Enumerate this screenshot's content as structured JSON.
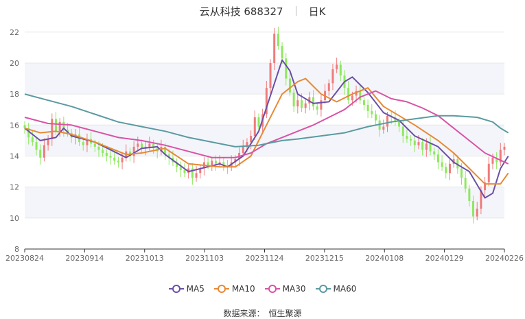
{
  "header": {
    "stock": "云从科技 688327",
    "period": "日K"
  },
  "chart_data": {
    "type": "candlestick",
    "y_ticks": [
      8,
      10,
      12,
      14,
      16,
      18,
      20,
      22
    ],
    "ylim": [
      8,
      22.3
    ],
    "x_ticks": [
      "20230824",
      "20230914",
      "20231013",
      "20231103",
      "20231124",
      "20231215",
      "20240108",
      "20240129",
      "20240226"
    ],
    "n_days": 124,
    "up_color": "#ef7b7b",
    "down_color": "#8ee85e",
    "grid": "horizontal",
    "shaded_bands": [
      [
        10,
        12
      ],
      [
        14,
        16
      ],
      [
        18,
        20
      ]
    ],
    "candles_close": [
      15.8,
      15.2,
      14.9,
      14.4,
      13.9,
      14.7,
      15.1,
      16.4,
      15.6,
      16.2,
      15.7,
      15.5,
      15.2,
      15.4,
      14.9,
      14.7,
      15.1,
      14.8,
      14.6,
      14.4,
      14.2,
      14.0,
      13.9,
      13.7,
      13.6,
      13.9,
      14.3,
      14.0,
      14.6,
      14.8,
      14.5,
      14.6,
      14.8,
      14.5,
      14.3,
      14.6,
      14.1,
      13.9,
      13.6,
      13.3,
      13.1,
      12.9,
      13.2,
      12.6,
      12.9,
      13.2,
      13.6,
      13.4,
      13.7,
      13.5,
      13.6,
      13.4,
      13.3,
      13.6,
      13.8,
      14.2,
      14.6,
      14.9,
      15.3,
      16.5,
      15.9,
      16.7,
      18.4,
      20.0,
      21.9,
      21.1,
      20.3,
      19.0,
      18.1,
      17.2,
      17.6,
      17.1,
      17.4,
      17.8,
      17.2,
      17.0,
      17.6,
      18.2,
      18.7,
      19.6,
      19.9,
      19.2,
      18.4,
      17.6,
      17.9,
      18.2,
      17.6,
      17.3,
      16.9,
      16.7,
      16.3,
      15.7,
      15.9,
      16.6,
      16.5,
      16.2,
      15.9,
      15.3,
      15.1,
      15.0,
      14.7,
      14.9,
      14.4,
      14.8,
      14.3,
      14.1,
      13.6,
      13.3,
      12.9,
      13.5,
      13.8,
      13.2,
      12.6,
      11.9,
      11.1,
      10.1,
      10.6,
      11.8,
      12.3,
      13.5,
      13.9,
      13.6,
      14.4,
      14.6
    ],
    "series": [
      {
        "name": "MA5",
        "color": "#6b4ea6",
        "points": [
          [
            0,
            15.8
          ],
          [
            4,
            15.0
          ],
          [
            8,
            15.2
          ],
          [
            10,
            15.8
          ],
          [
            12,
            15.3
          ],
          [
            18,
            14.9
          ],
          [
            26,
            13.9
          ],
          [
            30,
            14.5
          ],
          [
            34,
            14.6
          ],
          [
            36,
            14.1
          ],
          [
            42,
            13.0
          ],
          [
            50,
            13.5
          ],
          [
            52,
            13.3
          ],
          [
            56,
            14.0
          ],
          [
            60,
            15.6
          ],
          [
            66,
            20.2
          ],
          [
            68,
            19.5
          ],
          [
            70,
            18.0
          ],
          [
            74,
            17.4
          ],
          [
            78,
            17.5
          ],
          [
            82,
            18.8
          ],
          [
            84,
            19.1
          ],
          [
            88,
            18.1
          ],
          [
            92,
            16.8
          ],
          [
            96,
            16.3
          ],
          [
            100,
            15.3
          ],
          [
            106,
            14.6
          ],
          [
            110,
            13.6
          ],
          [
            114,
            13.0
          ],
          [
            118,
            11.3
          ],
          [
            120,
            11.6
          ],
          [
            122,
            13.2
          ],
          [
            124,
            14.0
          ]
        ]
      },
      {
        "name": "MA10",
        "color": "#e78934",
        "points": [
          [
            0,
            15.8
          ],
          [
            4,
            15.5
          ],
          [
            8,
            15.6
          ],
          [
            12,
            15.4
          ],
          [
            18,
            14.9
          ],
          [
            26,
            14.1
          ],
          [
            30,
            14.2
          ],
          [
            36,
            14.5
          ],
          [
            42,
            13.5
          ],
          [
            50,
            13.3
          ],
          [
            54,
            13.3
          ],
          [
            58,
            14.0
          ],
          [
            62,
            16.0
          ],
          [
            66,
            18.0
          ],
          [
            70,
            18.8
          ],
          [
            72,
            19.0
          ],
          [
            76,
            18.0
          ],
          [
            80,
            17.5
          ],
          [
            84,
            18.0
          ],
          [
            88,
            18.4
          ],
          [
            92,
            17.2
          ],
          [
            96,
            16.6
          ],
          [
            100,
            16.0
          ],
          [
            106,
            15.0
          ],
          [
            110,
            14.2
          ],
          [
            114,
            13.2
          ],
          [
            118,
            12.2
          ],
          [
            122,
            12.2
          ],
          [
            124,
            12.9
          ]
        ]
      },
      {
        "name": "MA30",
        "color": "#d853a6",
        "points": [
          [
            0,
            16.5
          ],
          [
            6,
            16.1
          ],
          [
            12,
            16.0
          ],
          [
            18,
            15.6
          ],
          [
            24,
            15.2
          ],
          [
            30,
            15.0
          ],
          [
            36,
            14.7
          ],
          [
            42,
            14.3
          ],
          [
            48,
            13.9
          ],
          [
            54,
            13.9
          ],
          [
            58,
            14.2
          ],
          [
            62,
            14.8
          ],
          [
            66,
            15.2
          ],
          [
            70,
            15.6
          ],
          [
            74,
            16.0
          ],
          [
            78,
            16.5
          ],
          [
            82,
            17.0
          ],
          [
            86,
            17.8
          ],
          [
            90,
            18.2
          ],
          [
            94,
            17.7
          ],
          [
            98,
            17.5
          ],
          [
            102,
            17.1
          ],
          [
            106,
            16.6
          ],
          [
            110,
            15.8
          ],
          [
            114,
            15.0
          ],
          [
            118,
            14.2
          ],
          [
            124,
            13.5
          ]
        ]
      },
      {
        "name": "MA60",
        "color": "#5a9aa0",
        "points": [
          [
            0,
            18.0
          ],
          [
            6,
            17.6
          ],
          [
            12,
            17.2
          ],
          [
            18,
            16.7
          ],
          [
            24,
            16.2
          ],
          [
            30,
            15.9
          ],
          [
            36,
            15.6
          ],
          [
            42,
            15.2
          ],
          [
            48,
            14.9
          ],
          [
            54,
            14.6
          ],
          [
            60,
            14.7
          ],
          [
            66,
            15.0
          ],
          [
            70,
            15.1
          ],
          [
            76,
            15.3
          ],
          [
            82,
            15.5
          ],
          [
            88,
            15.9
          ],
          [
            94,
            16.2
          ],
          [
            100,
            16.4
          ],
          [
            106,
            16.6
          ],
          [
            110,
            16.6
          ],
          [
            116,
            16.5
          ],
          [
            120,
            16.2
          ],
          [
            122,
            15.8
          ],
          [
            124,
            15.5
          ]
        ]
      }
    ]
  },
  "legend": {
    "items": [
      "MA5",
      "MA10",
      "MA30",
      "MA60"
    ]
  },
  "source": {
    "label": "数据来源：",
    "name": "恒生聚源"
  }
}
